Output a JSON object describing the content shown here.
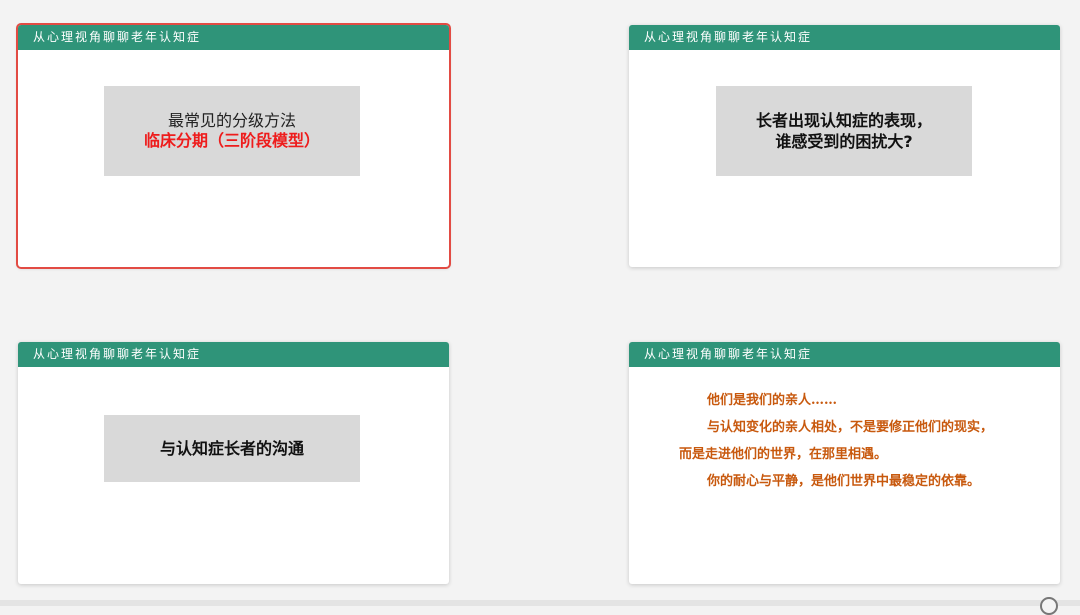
{
  "slides": [
    {
      "header": "从心理视角聊聊老年认知症",
      "line1": "最常见的分级方法",
      "line2": "临床分期（三阶段模型）",
      "selected": true
    },
    {
      "header": "从心理视角聊聊老年认知症",
      "line1": "长者出现认知症的表现，",
      "line2": "谁感受到的困扰大?"
    },
    {
      "header": "从心理视角聊聊老年认知症",
      "line1": "与认知症长者的沟通"
    },
    {
      "header": "从心理视角聊聊老年认知症",
      "paragraphs": [
        "他们是我们的亲人……",
        "与认知变化的亲人相处，不是要修正他们的现实，",
        "而是走进他们的世界，在那里相遇。",
        "你的耐心与平静，是他们世界中最稳定的依靠。"
      ]
    }
  ],
  "colors": {
    "header": "#2f9479",
    "selected_border": "#e24b43",
    "red_text": "#ee1c1c",
    "orange_text": "#c8590e"
  },
  "icons": [
    "circle-icon"
  ]
}
